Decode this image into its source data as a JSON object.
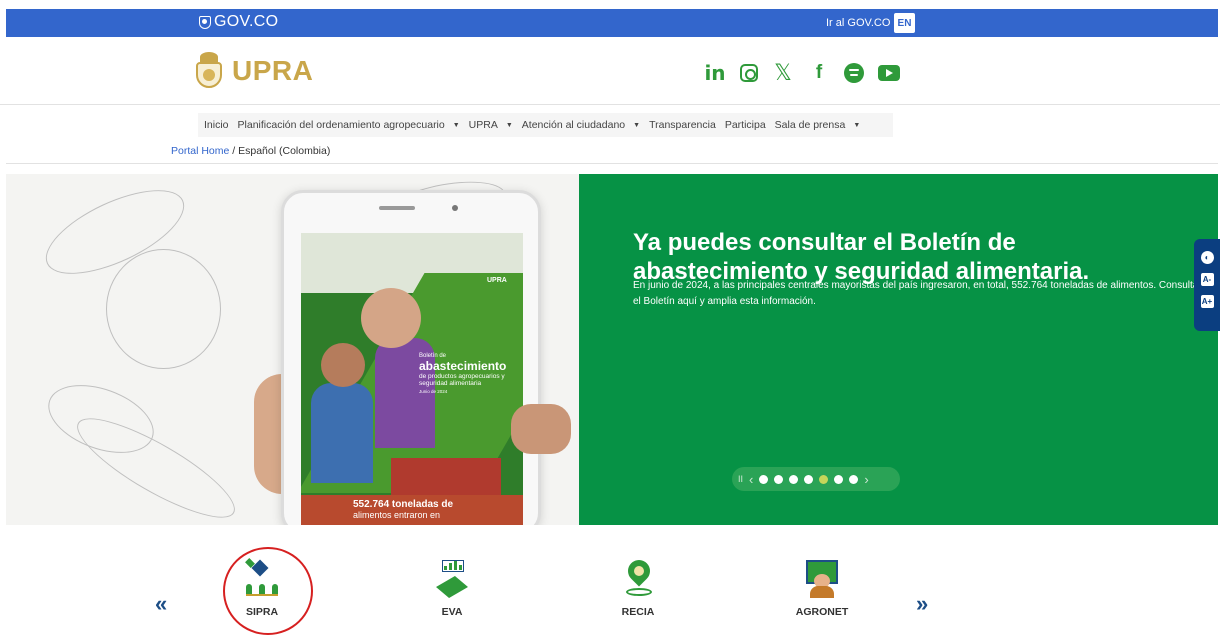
{
  "govbar": {
    "logo_text": "GOV.CO",
    "link_text": "Ir al GOV.CO",
    "lang_button": "EN",
    "color": "#3366cc"
  },
  "header": {
    "logo_text": "UPRA",
    "socials": [
      "linkedin-icon",
      "instagram-icon",
      "x-icon",
      "facebook-icon",
      "spotify-icon",
      "youtube-icon"
    ],
    "social_glyphs": {
      "linkedin": "in",
      "x": "𝕏",
      "facebook": "f"
    }
  },
  "nav": {
    "items": [
      {
        "label": "Inicio"
      },
      {
        "label": "Planificación del ordenamiento agropecuario"
      },
      {
        "label": "UPRA"
      },
      {
        "label": "Atención al ciudadano"
      },
      {
        "label": "Transparencia"
      },
      {
        "label": "Participa"
      },
      {
        "label": "Sala de prensa"
      }
    ],
    "caret": "▼"
  },
  "breadcrumb": {
    "link": "Portal Home",
    "separator": " / ",
    "current": "Español (Colombia)"
  },
  "carousel": {
    "title": "Ya puedes consultar el Boletín de abastecimiento y seguridad alimentaria.",
    "description": "En junio de 2024, a las principales centrales mayoristas del país ingresaron, en total, 552.764 toneladas de alimentos. Consulta el Boletín aquí y amplia esta información.",
    "panel_color": "#069245",
    "slide_count": 6,
    "active_slide": 4,
    "phone_screen": {
      "logo": "UPRA",
      "line1": "Boletín de",
      "line2": "abastecimiento",
      "line3": "de productos agropecuarios y seguridad alimentaria",
      "line4": "Junio de 2024",
      "stat1": "552.764 toneladas de",
      "stat2": "alimentos entraron en"
    },
    "controls": {
      "pause": "II",
      "prev": "‹",
      "next": "›"
    }
  },
  "accessibility": {
    "contrast_icon": "◐",
    "font_smaller": "A-",
    "font_larger": "A+"
  },
  "apps": {
    "prev": "«",
    "next": "»",
    "items": [
      {
        "label": "SIPRA",
        "icon": "satellite-crops-icon"
      },
      {
        "label": "EVA",
        "icon": "chart-land-icon"
      },
      {
        "label": "RECIA",
        "icon": "map-pin-icon"
      },
      {
        "label": "AGRONET",
        "icon": "farmer-board-icon"
      }
    ],
    "highlight_color": "#d62020"
  }
}
